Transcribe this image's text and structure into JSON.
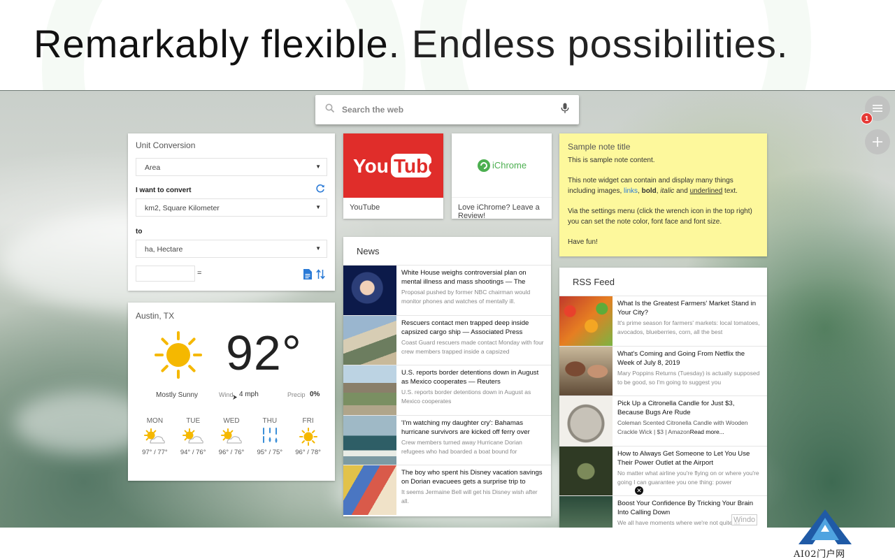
{
  "headline": {
    "bold": "Remarkably flexible",
    "light": ". Endless possibilities."
  },
  "search": {
    "placeholder": "Search the web"
  },
  "notifications": {
    "count": "1"
  },
  "unit_conversion": {
    "title": "Unit Conversion",
    "category": "Area",
    "convert_label": "I want to convert",
    "from_unit": "km2, Square Kilometer",
    "to_label": "to",
    "to_unit": "ha, Hectare",
    "equals": "="
  },
  "weather": {
    "city": "Austin, TX",
    "temperature": "92°",
    "condition": "Mostly Sunny",
    "wind_label": "Wind",
    "wind_value": "4 mph",
    "precip_label": "Precip",
    "precip_value": "0%",
    "forecast": [
      {
        "day": "MON",
        "icon": "partly-sunny-icon",
        "range": "97° / 77°"
      },
      {
        "day": "TUE",
        "icon": "partly-sunny-icon",
        "range": "94° / 76°"
      },
      {
        "day": "WED",
        "icon": "partly-sunny-icon",
        "range": "96° / 76°"
      },
      {
        "day": "THU",
        "icon": "rain-icon",
        "range": "95° / 75°"
      },
      {
        "day": "FRI",
        "icon": "sunny-icon",
        "range": "96° / 78°"
      }
    ]
  },
  "tiles": [
    {
      "label": "YouTube",
      "logo_text": "YouTube"
    },
    {
      "label": "Love iChrome? Leave a Review!",
      "logo_text": "iChrome"
    }
  ],
  "news": {
    "title": "News",
    "items": [
      {
        "headline": "White House weighs controversial plan on mental illness and mass shootings — The",
        "summary": "Proposal pushed by former NBC chairman would monitor phones and watches of mentally ill."
      },
      {
        "headline": "Rescuers contact men trapped deep inside capsized cargo ship — Associated Press",
        "summary": "Coast Guard rescuers made contact Monday with four crew members trapped inside a capsized"
      },
      {
        "headline": "U.S. reports border detentions down in August as Mexico cooperates — Reuters",
        "summary": "U.S. reports border detentions down in August as Mexico cooperates"
      },
      {
        "headline": "'I'm watching my daughter cry': Bahamas hurricane survivors are kicked off ferry over",
        "summary": "Crew members turned away Hurricane Dorian refugees who had boarded a boat bound for"
      },
      {
        "headline": "The boy who spent his Disney vacation savings on Dorian evacuees gets a surprise trip to",
        "summary": "It seems Jermaine Bell will get his Disney wish after all."
      }
    ]
  },
  "note": {
    "title": "Sample note title",
    "line1": "This is sample note content.",
    "line2_start": "This note widget can contain and display many things including images, ",
    "link_text": "links",
    "comma1": ", ",
    "bold_text": "bold",
    "comma2": ", ",
    "italic_text": "italic",
    "and_text": " and ",
    "underlined_text": "underlined",
    "line2_end": " text.",
    "line3": "Via the settings menu (click the wrench icon in the top right) you can set the note color, font face and font size.",
    "line4": "Have fun!"
  },
  "rss": {
    "title": "RSS Feed",
    "items": [
      {
        "headline": "What Is the Greatest Farmers' Market Stand in Your City?",
        "summary": "It's prime season for farmers' markets: local tomatoes, avocados, blueberries, corn, all the best"
      },
      {
        "headline": "What's Coming and Going From Netflix the Week of July 8, 2019",
        "summary": "Mary Poppins Returns (Tuesday) is actually supposed to be good, so I'm going to suggest you"
      },
      {
        "headline": "Pick Up a Citronella Candle for Just $3, Because Bugs Are Rude",
        "summary": "Coleman Scented Citronella Candle with Wooden Crackle Wick | $3 | Amazon",
        "more": "Read more..."
      },
      {
        "headline": "How to Always Get Someone to Let You Use Their Power Outlet at the Airport",
        "summary": "No matter what airline you're flying on or where you're going I can guarantee you one thing: power"
      },
      {
        "headline": "Boost Your Confidence By Tricking Your Brain Into Calling Down",
        "summary": "We all have moments where we're not quite as"
      }
    ]
  },
  "overlay": {
    "close": "✕",
    "windo_text": "Windo"
  },
  "watermark": {
    "text": "AI02门户网"
  },
  "colors": {
    "youtube_red": "#e02d2a",
    "note_yellow": "#fdf89c",
    "accent_blue": "#2a7ad6",
    "badge_red": "#e53935",
    "sun": "#f5b800"
  }
}
